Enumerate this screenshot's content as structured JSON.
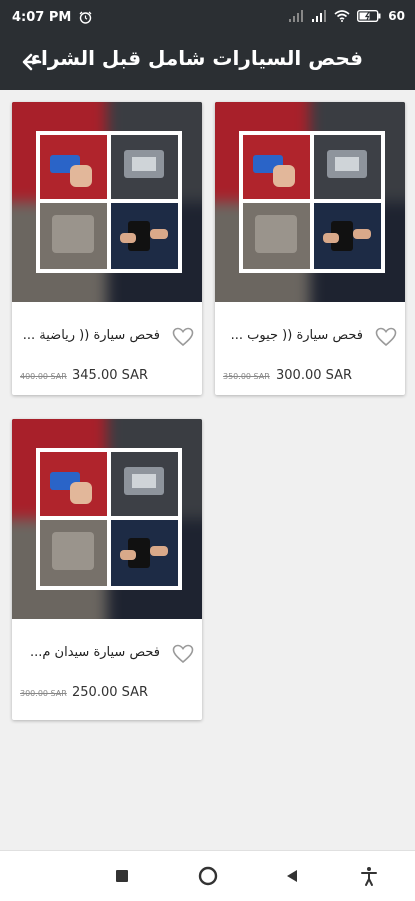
{
  "status_bar": {
    "time": "4:07 PM",
    "battery": "60"
  },
  "app_bar": {
    "title": "فحص السيارات شامل قبل الشراء",
    "back_icon": "arrow-left-icon"
  },
  "products": [
    {
      "name": "فحص سيارة (( جيوب ...",
      "old_price": "350.00 SAR",
      "price": "300.00 SAR"
    },
    {
      "name": "فحص سيارة (( رياضية ...",
      "old_price": "400.00 SAR",
      "price": "345.00 SAR"
    },
    {
      "name": "فحص سيارة سيدان م...",
      "old_price": "300.00 SAR",
      "price": "250.00 SAR"
    }
  ],
  "icons": {
    "favorite": "heart-outline-icon",
    "alarm": "alarm-icon",
    "wifi": "wifi-icon",
    "signal": "signal-icon",
    "battery": "battery-icon"
  },
  "nav_bar": {
    "buttons": [
      "recents-square-icon",
      "home-circle-icon",
      "back-triangle-icon",
      "accessibility-icon"
    ]
  }
}
